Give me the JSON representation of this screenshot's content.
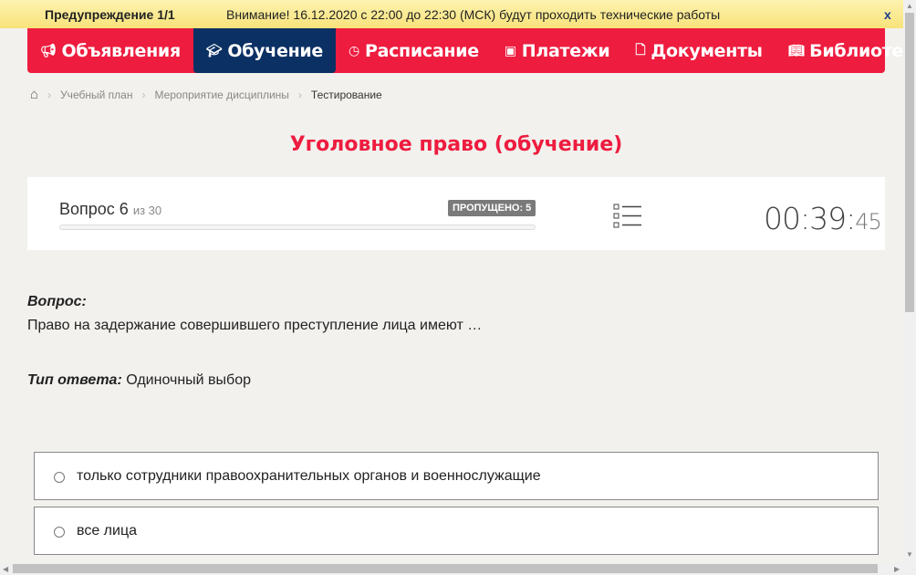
{
  "warning": {
    "title": "Предупреждение 1/1",
    "message": "Внимание! 16.12.2020 с 22:00 до 22:30 (МСК) будут проходить технические работы",
    "close": "x"
  },
  "nav": [
    {
      "label": "Объявления",
      "icon": "megaphone-icon"
    },
    {
      "label": "Обучение",
      "icon": "graduation-cap-icon",
      "active": true
    },
    {
      "label": "Расписание",
      "icon": "clock-icon"
    },
    {
      "label": "Платежи",
      "icon": "money-icon"
    },
    {
      "label": "Документы",
      "icon": "document-icon"
    },
    {
      "label": "Библиотека",
      "icon": "book-icon"
    }
  ],
  "breadcrumb": [
    "Учебный план",
    "Мероприятие дисциплины",
    "Тестирование"
  ],
  "title": "Уголовное право (обучение)",
  "progress": {
    "question_label": "Вопрос 6",
    "of": "из 30",
    "skipped": "ПРОПУЩЕНО: 5",
    "fraction": 0.0,
    "timer_main": "00:39:",
    "timer_sec": "45"
  },
  "question": {
    "label": "Вопрос:",
    "text": "Право на задержание совершившего преступление лица имеют …",
    "type_label": "Тип ответа:",
    "type_value": "Одиночный выбор"
  },
  "options": [
    "только сотрудники правоохранительных органов и военнослужащие",
    "все лица"
  ]
}
